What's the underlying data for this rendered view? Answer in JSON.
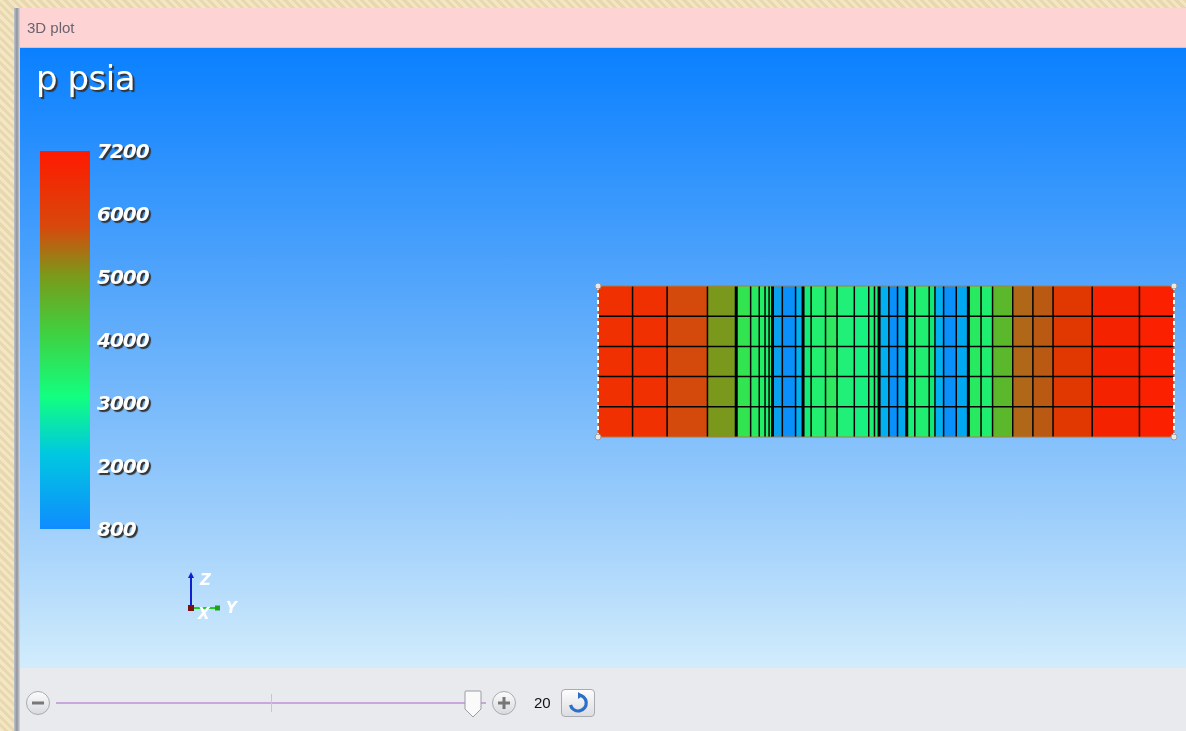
{
  "panel": {
    "title": "3D plot"
  },
  "legend": {
    "title": "p psia",
    "labels": [
      "7200",
      "6000",
      "5000",
      "4000",
      "3000",
      "2000",
      "800"
    ]
  },
  "axes": {
    "labels": [
      "Z",
      "X",
      "Y"
    ]
  },
  "zoom": {
    "level": 0.97,
    "value": "20"
  }
}
